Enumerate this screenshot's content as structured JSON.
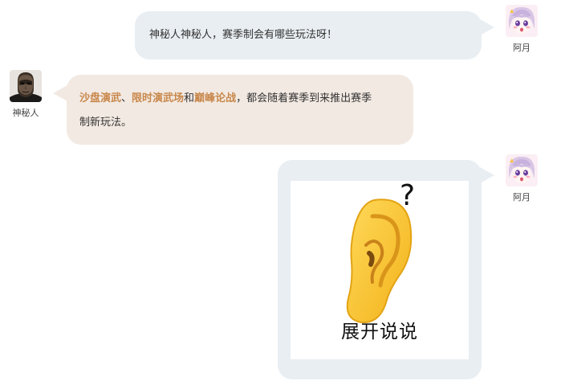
{
  "messages": [
    {
      "side": "right",
      "sender": "阿月",
      "text": "神秘人神秘人，赛季制会有哪些玩法呀！"
    },
    {
      "side": "left",
      "sender": "神秘人",
      "parts": [
        {
          "text": "沙盘演武",
          "highlight": true
        },
        {
          "text": "、",
          "highlight": false
        },
        {
          "text": "限时演武场",
          "highlight": true
        },
        {
          "text": "和",
          "highlight": false
        },
        {
          "text": "巅峰论战",
          "highlight": true
        },
        {
          "text": "，都会随着赛季到来推出赛季",
          "highlight": false
        },
        {
          "text": "制新玩法。",
          "highlight": false
        }
      ]
    },
    {
      "side": "right",
      "sender": "阿月",
      "sticker": {
        "icon": "ear-icon",
        "mark": "?",
        "caption": "展开说说"
      }
    }
  ],
  "colors": {
    "right_bubble": "#e9eef2",
    "left_bubble": "#f2e9e2",
    "highlight": "#c8874a"
  }
}
